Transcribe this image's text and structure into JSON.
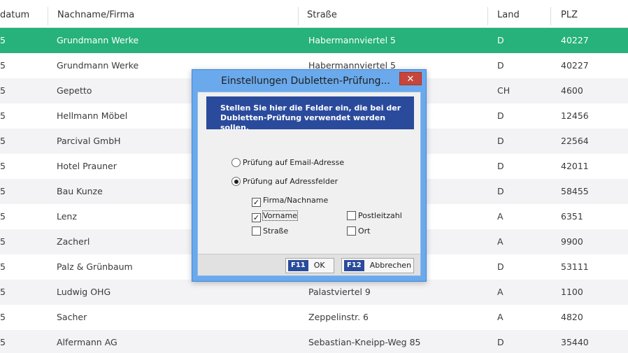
{
  "table": {
    "columns": [
      "datum",
      "Nachname/Firma",
      "Straße",
      "Land",
      "PLZ"
    ],
    "rows": [
      {
        "date": "5",
        "name": "Grundmann Werke",
        "street": "Habermannviertel 5",
        "land": "D",
        "plz": "40227"
      },
      {
        "date": "5",
        "name": "Grundmann Werke",
        "street": "Habermannviertel 5",
        "land": "D",
        "plz": "40227"
      },
      {
        "date": "5",
        "name": "Gepetto",
        "street": "",
        "land": "CH",
        "plz": "4600"
      },
      {
        "date": "5",
        "name": "Hellmann Möbel",
        "street": "",
        "land": "D",
        "plz": "12456"
      },
      {
        "date": "5",
        "name": "Parcival GmbH",
        "street": "",
        "land": "D",
        "plz": "22564"
      },
      {
        "date": "5",
        "name": "Hotel Prauner",
        "street": "",
        "land": "D",
        "plz": "42011"
      },
      {
        "date": "5",
        "name": "Bau Kunze",
        "street": "",
        "land": "D",
        "plz": "58455"
      },
      {
        "date": "5",
        "name": "Lenz",
        "street": "",
        "land": "A",
        "plz": "6351"
      },
      {
        "date": "5",
        "name": "Zacherl",
        "street": "",
        "land": "A",
        "plz": "9900"
      },
      {
        "date": "5",
        "name": "Palz & Grünbaum",
        "street": "",
        "land": "D",
        "plz": "53111"
      },
      {
        "date": "5",
        "name": "Ludwig OHG",
        "street": "Palastviertel 9",
        "land": "A",
        "plz": "1100"
      },
      {
        "date": "5",
        "name": "Sacher",
        "street": "Zeppelinstr. 6",
        "land": "A",
        "plz": "4820"
      },
      {
        "date": "5",
        "name": "Alfermann AG",
        "street": "Sebastian-Kneipp-Weg 85",
        "land": "D",
        "plz": "35440"
      }
    ],
    "selected_row": 0
  },
  "dialog": {
    "title": "Einstellungen Dubletten-Prüfung...",
    "close_glyph": "✕",
    "banner_line1": "Stellen Sie hier die Felder ein, die bei der",
    "banner_line2": "Dubletten-Prüfung verwendet werden sollen.",
    "radio_email": "Prüfung auf Email-Adresse",
    "radio_address": "Prüfung auf Adressfelder",
    "chk_firma": "Firma/Nachname",
    "chk_vorname": "Vorname",
    "chk_strasse": "Straße",
    "chk_plz": "Postleitzahl",
    "chk_ort": "Ort",
    "check_glyph": "✓",
    "ok_key": "F11",
    "ok_label": "OK",
    "cancel_key": "F12",
    "cancel_label": "Abbrechen"
  },
  "colors": {
    "selected_row": "#26b27a",
    "dialog_frame": "#6aa9ec",
    "banner": "#2a4b9c",
    "close_button": "#c7453b"
  }
}
